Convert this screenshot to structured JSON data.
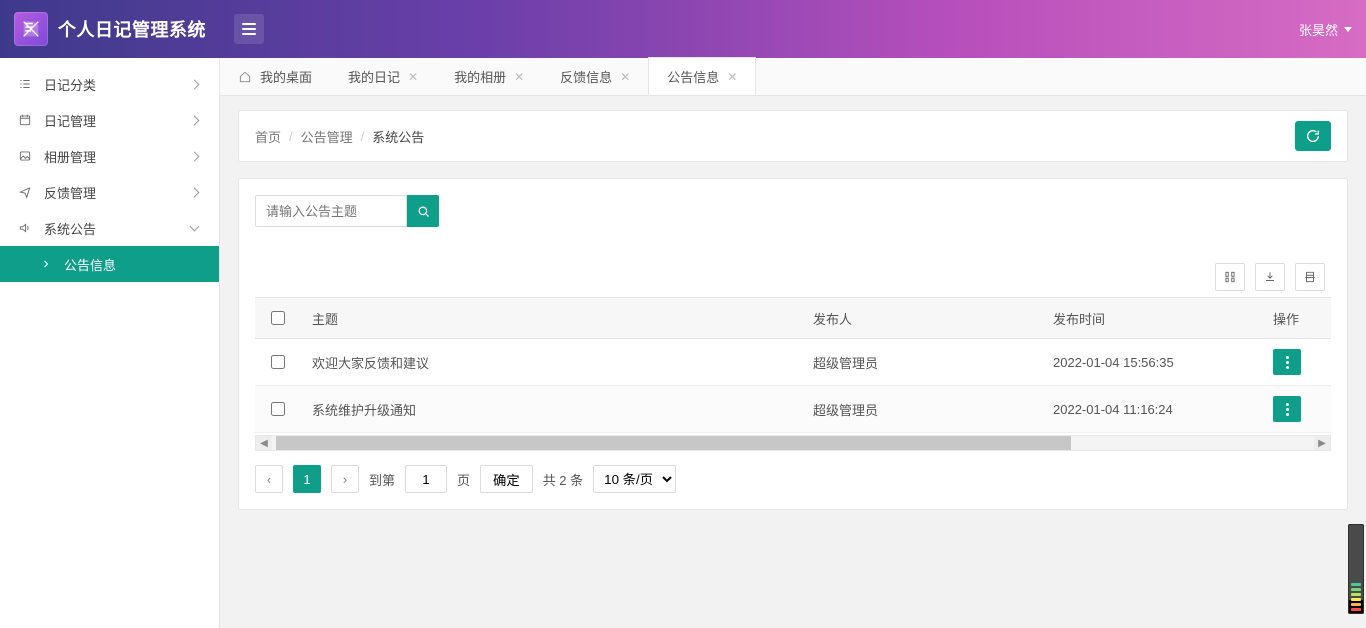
{
  "app_title": "个人日记管理系统",
  "user_name": "张昊然",
  "sidebar": {
    "items": [
      {
        "label": "日记分类",
        "expanded": false,
        "icon": "list"
      },
      {
        "label": "日记管理",
        "expanded": false,
        "icon": "calendar"
      },
      {
        "label": "相册管理",
        "expanded": false,
        "icon": "image"
      },
      {
        "label": "反馈管理",
        "expanded": false,
        "icon": "share"
      },
      {
        "label": "系统公告",
        "expanded": true,
        "icon": "sound"
      }
    ],
    "sub_active": {
      "label": "公告信息"
    }
  },
  "tabs": [
    {
      "label": "我的桌面",
      "icon": "home",
      "closable": false,
      "active": false
    },
    {
      "label": "我的日记",
      "closable": true,
      "active": false
    },
    {
      "label": "我的相册",
      "closable": true,
      "active": false
    },
    {
      "label": "反馈信息",
      "closable": true,
      "active": false
    },
    {
      "label": "公告信息",
      "closable": true,
      "active": true
    }
  ],
  "breadcrumb": {
    "home": "首页",
    "section": "公告管理",
    "current": "系统公告"
  },
  "search": {
    "placeholder": "请输入公告主题"
  },
  "table": {
    "columns": {
      "topic": "主题",
      "publisher": "发布人",
      "publish_time": "发布时间",
      "action": "操作"
    },
    "rows": [
      {
        "topic": "欢迎大家反馈和建议",
        "publisher": "超级管理员",
        "publish_time": "2022-01-04 15:56:35"
      },
      {
        "topic": "系统维护升级通知",
        "publisher": "超级管理员",
        "publish_time": "2022-01-04 11:16:24"
      }
    ]
  },
  "pager": {
    "current": "1",
    "goto_prefix": "到第",
    "goto_value": "1",
    "goto_suffix": "页",
    "confirm": "确定",
    "total": "共 2 条",
    "per_page": "10 条/页"
  }
}
